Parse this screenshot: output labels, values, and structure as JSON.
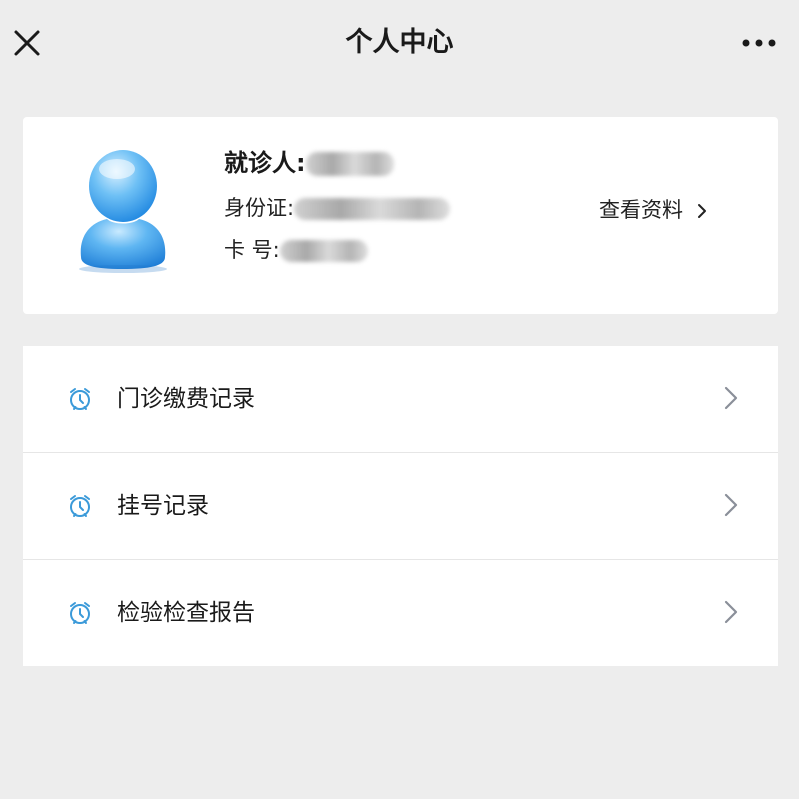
{
  "header": {
    "title": "个人中心",
    "close_icon": "close-icon",
    "more_icon": "more-dots-icon"
  },
  "profile": {
    "avatar_icon": "user-avatar-icon",
    "name_label": "就诊人:",
    "id_label": "身份证:",
    "card_label": "卡 号:",
    "view_label": "查看资料",
    "view_icon": "chevron-right-icon"
  },
  "menu": {
    "items": [
      {
        "label": "门诊缴费记录",
        "icon": "alarm-clock-icon"
      },
      {
        "label": "挂号记录",
        "icon": "alarm-clock-icon"
      },
      {
        "label": "检验检查报告",
        "icon": "alarm-clock-icon"
      }
    ]
  },
  "colors": {
    "background": "#ededed",
    "card": "#ffffff",
    "icon_accent": "#3b9ad9",
    "chevron": "#8a8f99"
  }
}
